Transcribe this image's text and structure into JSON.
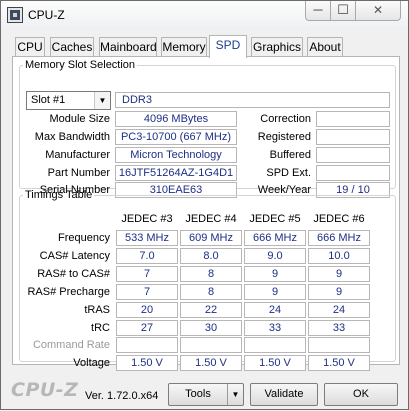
{
  "window": {
    "title": "CPU-Z",
    "min_label": "─",
    "max_label": "☐",
    "close_label": "✕"
  },
  "tabs": [
    {
      "label": "CPU"
    },
    {
      "label": "Caches"
    },
    {
      "label": "Mainboard"
    },
    {
      "label": "Memory"
    },
    {
      "label": "SPD"
    },
    {
      "label": "Graphics"
    },
    {
      "label": "About"
    }
  ],
  "active_tab": "SPD",
  "slot_section": {
    "title": "Memory Slot Selection",
    "slot_selected": "Slot #1",
    "memory_type": "DDR3",
    "module_size_label": "Module Size",
    "module_size": "4096 MBytes",
    "max_bandwidth_label": "Max Bandwidth",
    "max_bandwidth": "PC3-10700 (667 MHz)",
    "manufacturer_label": "Manufacturer",
    "manufacturer": "Micron Technology",
    "part_number_label": "Part Number",
    "part_number": "16JTF51264AZ-1G4D1",
    "serial_number_label": "Serial Number",
    "serial_number": "310EAE63",
    "correction_label": "Correction",
    "correction": "",
    "registered_label": "Registered",
    "registered": "",
    "buffered_label": "Buffered",
    "buffered": "",
    "spd_ext_label": "SPD Ext.",
    "spd_ext": "",
    "week_year_label": "Week/Year",
    "week_year": "19 / 10"
  },
  "timings": {
    "title": "Timings Table",
    "columns": [
      "JEDEC #3",
      "JEDEC #4",
      "JEDEC #5",
      "JEDEC #6"
    ],
    "rows": [
      {
        "label": "Frequency",
        "values": [
          "533 MHz",
          "609 MHz",
          "666 MHz",
          "666 MHz"
        ]
      },
      {
        "label": "CAS# Latency",
        "values": [
          "7.0",
          "8.0",
          "9.0",
          "10.0"
        ]
      },
      {
        "label": "RAS# to CAS#",
        "values": [
          "7",
          "8",
          "9",
          "9"
        ]
      },
      {
        "label": "RAS# Precharge",
        "values": [
          "7",
          "8",
          "9",
          "9"
        ]
      },
      {
        "label": "tRAS",
        "values": [
          "20",
          "22",
          "24",
          "24"
        ]
      },
      {
        "label": "tRC",
        "values": [
          "27",
          "30",
          "33",
          "33"
        ]
      },
      {
        "label": "Command Rate",
        "values": [
          "",
          "",
          "",
          ""
        ]
      },
      {
        "label": "Voltage",
        "values": [
          "1.50 V",
          "1.50 V",
          "1.50 V",
          "1.50 V"
        ]
      }
    ]
  },
  "footer": {
    "logo": "CPU-Z",
    "version": "Ver. 1.72.0.x64",
    "tools_label": "Tools",
    "validate_label": "Validate",
    "ok_label": "OK"
  }
}
